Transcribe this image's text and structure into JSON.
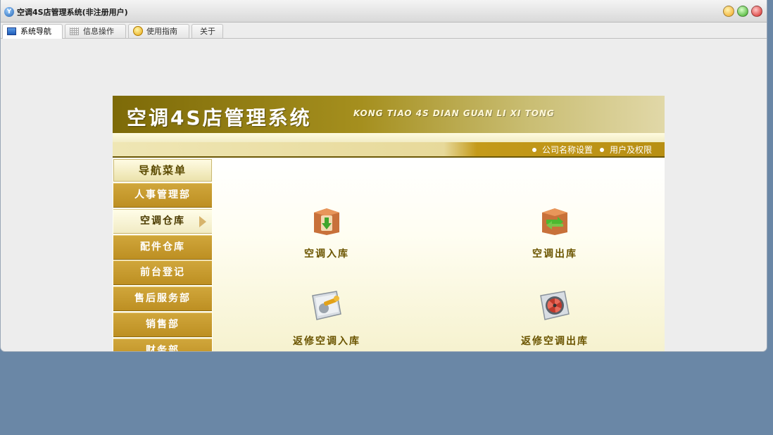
{
  "window": {
    "title": "空调4S店管理系统(非注册用户)"
  },
  "tabs": [
    {
      "label": "系统导航",
      "icon": "monitor-icon",
      "active": true
    },
    {
      "label": "信息操作",
      "icon": "grid-icon",
      "active": false
    },
    {
      "label": "使用指南",
      "icon": "bulb-icon",
      "active": false
    },
    {
      "label": "关于",
      "icon": "",
      "active": false
    }
  ],
  "banner": {
    "title": "空调4S店管理系统",
    "pinyin": "KONG TIAO  4S DIAN GUAN LI XI TONG"
  },
  "links": {
    "company_settings": "公司名称设置",
    "users_permissions": "用户及权限"
  },
  "menu": {
    "header": "导航菜单",
    "items": [
      {
        "label": "人事管理部"
      },
      {
        "label": "空调仓库"
      },
      {
        "label": "配件仓库"
      },
      {
        "label": "前台登记"
      },
      {
        "label": "售后服务部"
      },
      {
        "label": "销售部"
      },
      {
        "label": "财务部"
      }
    ],
    "active_index": 1
  },
  "functions": [
    {
      "label": "空调入库",
      "icon": "box-down-arrow-icon"
    },
    {
      "label": "空调出库",
      "icon": "box-swap-arrows-icon"
    },
    {
      "label": "返修空调入库",
      "icon": "repair-wrench-icon"
    },
    {
      "label": "返修空调出库",
      "icon": "fan-unit-icon"
    }
  ],
  "colors": {
    "accent_gold": "#bd8f22",
    "banner_olive": "#7d6a08",
    "desktop": "#6a87a6"
  }
}
